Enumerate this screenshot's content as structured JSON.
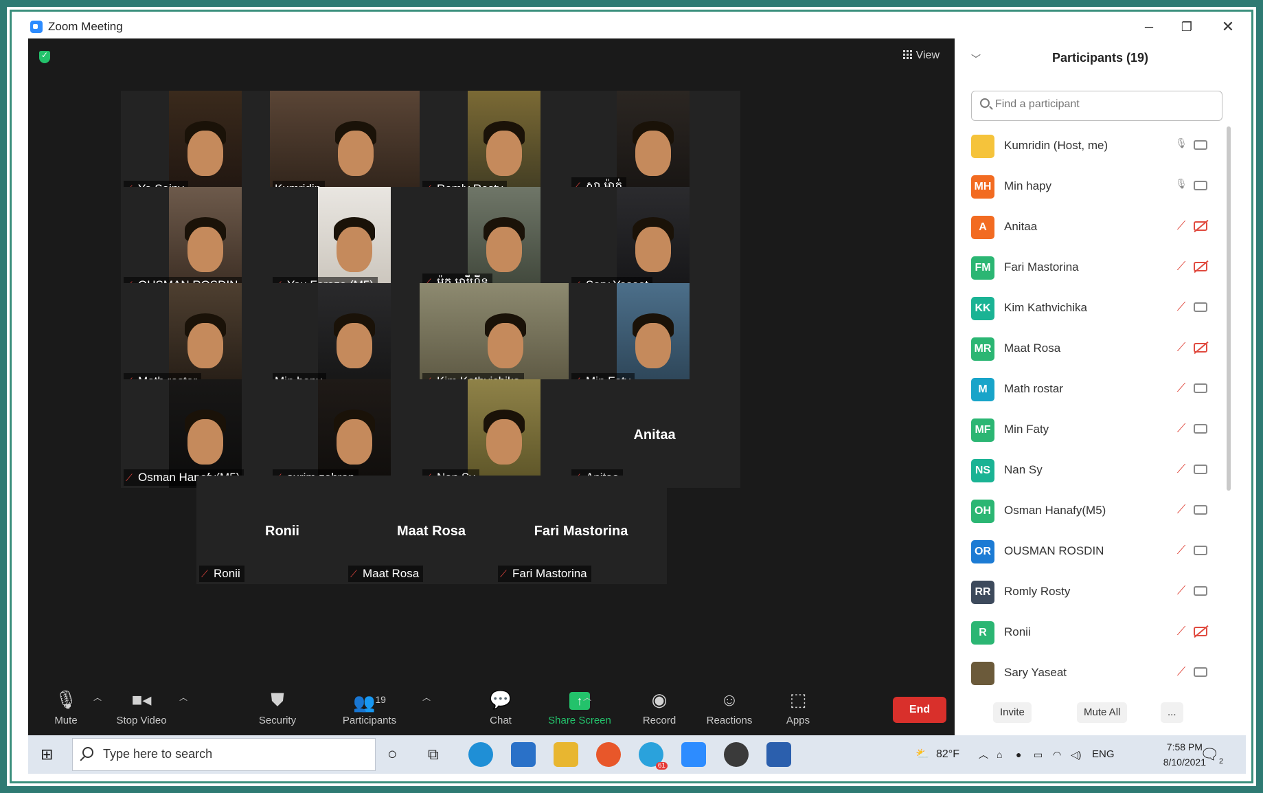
{
  "window": {
    "title": "Zoom Meeting"
  },
  "view_label": "View",
  "tiles": [
    {
      "name": "Ya Sainy",
      "muted": true,
      "video": true,
      "active": false
    },
    {
      "name": "Kumridin",
      "muted": false,
      "video": true,
      "active": true
    },
    {
      "name": "Romly Rosty",
      "muted": true,
      "video": true,
      "active": false
    },
    {
      "name": "ស្លា ម៉ាត់",
      "muted": true,
      "video": true,
      "active": false
    },
    {
      "name": "OUSMAN ROSDIN",
      "muted": true,
      "video": true,
      "active": false
    },
    {
      "name": "You Faraza (M5)",
      "muted": true,
      "video": true,
      "active": false
    },
    {
      "name": "ម៉ូត អារីហ្វីន",
      "muted": true,
      "video": true,
      "active": false
    },
    {
      "name": "Sary Yaseat",
      "muted": true,
      "video": true,
      "active": false
    },
    {
      "name": "Math rostar",
      "muted": true,
      "video": true,
      "active": false
    },
    {
      "name": "Min hapy",
      "muted": false,
      "video": true,
      "active": false
    },
    {
      "name": "Kim Kathvichika",
      "muted": true,
      "video": true,
      "active": false
    },
    {
      "name": "Min Faty",
      "muted": true,
      "video": true,
      "active": false
    },
    {
      "name": "Osman Hanafy(M5)",
      "muted": true,
      "video": true,
      "active": false
    },
    {
      "name": "surim zahron",
      "muted": true,
      "video": true,
      "active": false
    },
    {
      "name": "Nan Sy",
      "muted": true,
      "video": true,
      "active": false
    },
    {
      "name": "Anitaa",
      "muted": true,
      "video": false,
      "active": false
    },
    {
      "name": "Ronii",
      "muted": true,
      "video": false,
      "active": false
    },
    {
      "name": "Maat Rosa",
      "muted": true,
      "video": false,
      "active": false
    },
    {
      "name": "Fari Mastorina",
      "muted": true,
      "video": false,
      "active": false
    }
  ],
  "toolbar": {
    "mute": "Mute",
    "stop_video": "Stop Video",
    "security": "Security",
    "participants": "Participants",
    "participants_count": "19",
    "chat": "Chat",
    "share_screen": "Share Screen",
    "record": "Record",
    "reactions": "Reactions",
    "apps": "Apps",
    "end": "End"
  },
  "panel": {
    "title": "Participants (19)",
    "search_placeholder": "Find a participant",
    "participants": [
      {
        "initials": "",
        "name": "Kumridin (Host, me)",
        "color": "#f5c33b",
        "mic": "on",
        "cam": "on"
      },
      {
        "initials": "MH",
        "name": "Min hapy",
        "color": "#f26b21",
        "mic": "on",
        "cam": "on"
      },
      {
        "initials": "A",
        "name": "Anitaa",
        "color": "#f26b21",
        "mic": "off",
        "cam": "off"
      },
      {
        "initials": "FM",
        "name": "Fari Mastorina",
        "color": "#2bb673",
        "mic": "off",
        "cam": "off"
      },
      {
        "initials": "KK",
        "name": "Kim Kathvichika",
        "color": "#1ab394",
        "mic": "off",
        "cam": "on"
      },
      {
        "initials": "MR",
        "name": "Maat Rosa",
        "color": "#2bb673",
        "mic": "off",
        "cam": "off"
      },
      {
        "initials": "M",
        "name": "Math rostar",
        "color": "#18a4c9",
        "mic": "off",
        "cam": "on"
      },
      {
        "initials": "MF",
        "name": "Min Faty",
        "color": "#2bb673",
        "mic": "off",
        "cam": "on"
      },
      {
        "initials": "NS",
        "name": "Nan Sy",
        "color": "#1ab394",
        "mic": "off",
        "cam": "on"
      },
      {
        "initials": "OH",
        "name": "Osman Hanafy(M5)",
        "color": "#2bb673",
        "mic": "off",
        "cam": "on"
      },
      {
        "initials": "OR",
        "name": "OUSMAN ROSDIN",
        "color": "#1c7bd4",
        "mic": "off",
        "cam": "on"
      },
      {
        "initials": "RR",
        "name": "Romly Rosty",
        "color": "#3d4a5c",
        "mic": "off",
        "cam": "on"
      },
      {
        "initials": "R",
        "name": "Ronii",
        "color": "#2bb673",
        "mic": "off",
        "cam": "off"
      },
      {
        "initials": "",
        "name": "Sary Yaseat",
        "color": "#6b5a3a",
        "mic": "off",
        "cam": "on"
      }
    ],
    "invite": "Invite",
    "mute_all": "Mute All",
    "more": "..."
  },
  "taskbar": {
    "search_placeholder": "Type here to search",
    "weather": "82°F",
    "lang": "ENG",
    "time": "7:58 PM",
    "date": "8/10/2021",
    "notif_count": "2",
    "telegram_badge": "61"
  },
  "colors": {
    "stage_bg": "#1a1a1a",
    "active_speaker": "#e8e87a",
    "end_button": "#d9302b",
    "share_screen": "#23c26b"
  }
}
